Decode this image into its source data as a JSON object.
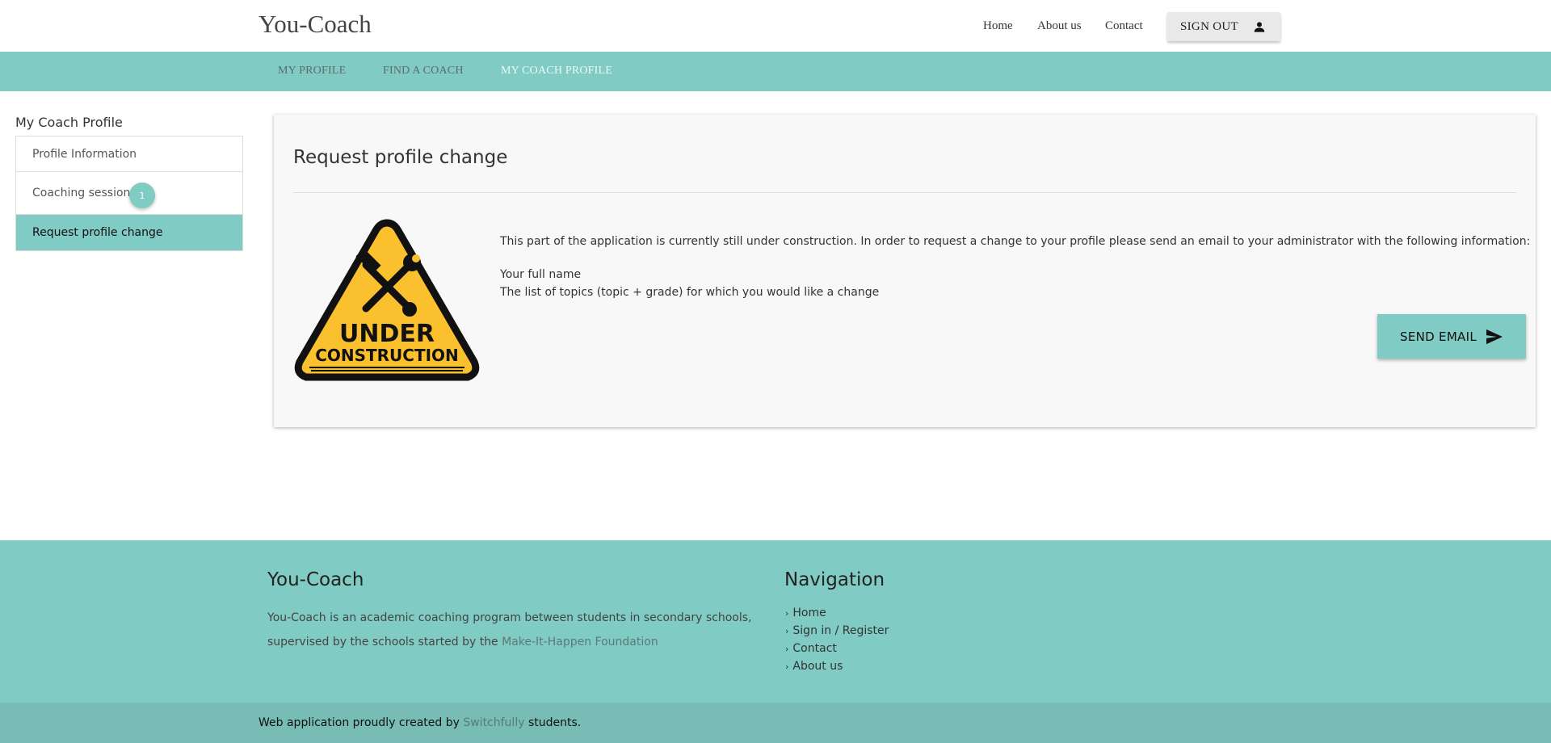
{
  "header": {
    "brand": "You-Coach",
    "nav": {
      "home": "Home",
      "about": "About us",
      "contact": "Contact"
    },
    "signout_label": "SIGN OUT",
    "signout_icon": "person-icon"
  },
  "subnav": {
    "tabs": [
      "MY PROFILE",
      "FIND A COACH",
      "MY COACH PROFILE"
    ],
    "active_tab": "MY COACH PROFILE"
  },
  "sidebar": {
    "title": "My Coach Profile",
    "items": [
      {
        "label": "Profile Information"
      },
      {
        "label": "Coaching sessions",
        "badge": "1"
      },
      {
        "label": "Request profile change",
        "active": true
      }
    ]
  },
  "main": {
    "title": "Request profile change",
    "image_text": [
      "UNDER",
      "CONSTRUCTION"
    ],
    "message": "This part of the application is currently still under construction. In order to request a change to your profile please send an email to your administrator with the following information:",
    "items": [
      "Your full name",
      "The list of topics (topic + grade) for which you would like a change"
    ],
    "send_label": "SEND EMAIL",
    "send_icon": "send-icon"
  },
  "footer": {
    "brand_title": "You-Coach",
    "description_prefix": "You-Coach is an academic coaching program between students in secondary schools, supervised by the schools started by the ",
    "description_link": "Make-It-Happen Foundation",
    "nav_title": "Navigation",
    "nav_links": [
      "Home",
      "Sign in / Register",
      "Contact",
      "About us"
    ],
    "credit_prefix": "Web application proudly created by ",
    "credit_link": "Switchfully",
    "credit_suffix": " students."
  },
  "colors": {
    "accent": "#80cbc4",
    "footer_bottom": "#77bcb5",
    "sign_yellow": "#fbc02d"
  }
}
